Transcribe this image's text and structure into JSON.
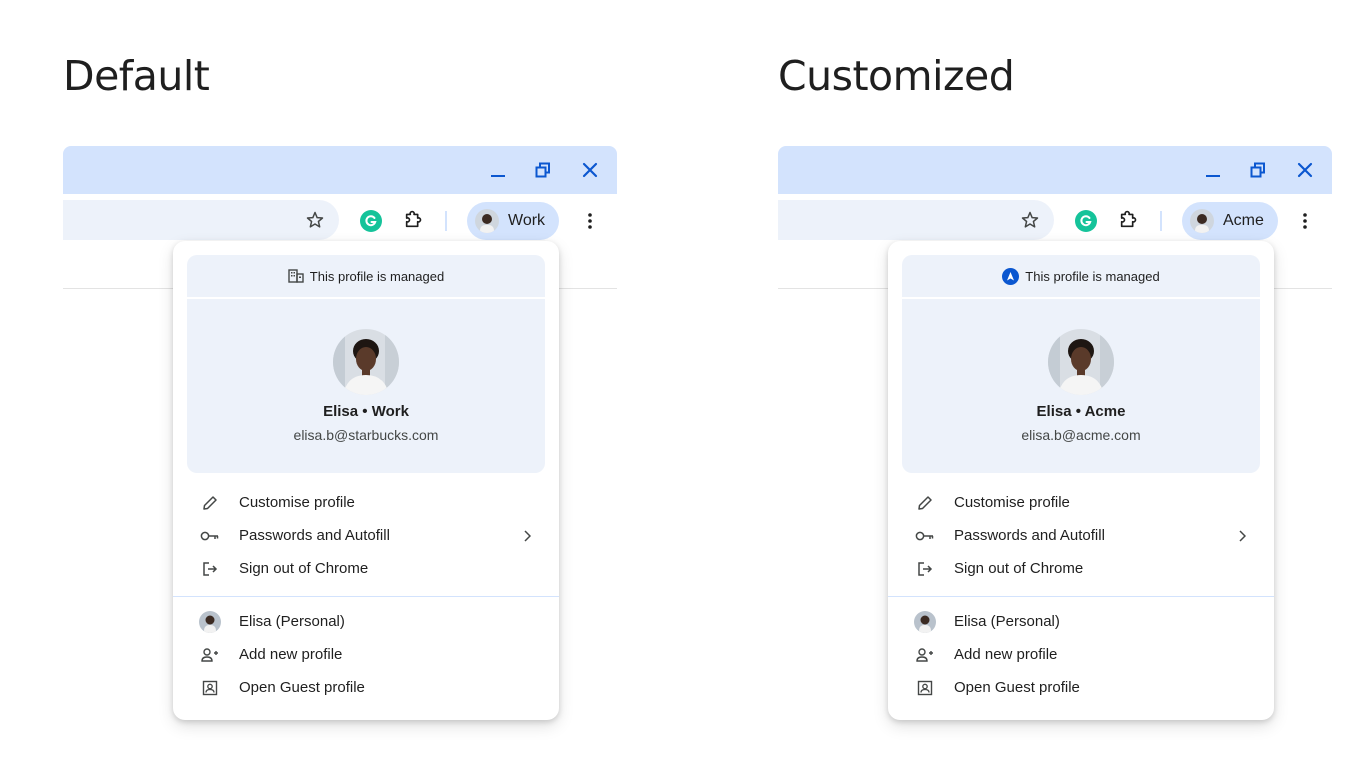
{
  "panels": [
    {
      "heading": "Default",
      "chip_label": "Work",
      "managed_text": "This profile is managed",
      "managed_icon": "building-icon",
      "profile_name": "Elisa • Work",
      "profile_email": "elisa.b@starbucks.com",
      "menu_items": [
        {
          "label": "Customise profile",
          "icon": "pencil-icon"
        },
        {
          "label": "Passwords and Autofill",
          "icon": "key-icon"
        },
        {
          "label": "Sign out of Chrome",
          "icon": "sign-out-icon"
        }
      ],
      "other_profiles": [
        {
          "label": "Elisa (Personal)",
          "icon": "avatar"
        },
        {
          "label": "Add new profile",
          "icon": "add-person-icon"
        },
        {
          "label": "Open Guest profile",
          "icon": "guest-icon"
        }
      ]
    },
    {
      "heading": "Customized",
      "chip_label": "Acme",
      "managed_text": "This profile is managed",
      "managed_icon": "acme-logo-icon",
      "profile_name": "Elisa • Acme",
      "profile_email": "elisa.b@acme.com",
      "menu_items": [
        {
          "label": "Customise profile",
          "icon": "pencil-icon"
        },
        {
          "label": "Passwords and Autofill",
          "icon": "key-icon"
        },
        {
          "label": "Sign out of Chrome",
          "icon": "sign-out-icon"
        }
      ],
      "other_profiles": [
        {
          "label": "Elisa (Personal)",
          "icon": "avatar"
        },
        {
          "label": "Add new profile",
          "icon": "add-person-icon"
        },
        {
          "label": "Open Guest profile",
          "icon": "guest-icon"
        }
      ]
    }
  ],
  "colors": {
    "titlebar": "#d3e3fd",
    "omnibox": "#edf2fa",
    "accent": "#0b57d0",
    "menu_card": "#edf2fa",
    "grammarly": "#15c39a"
  }
}
